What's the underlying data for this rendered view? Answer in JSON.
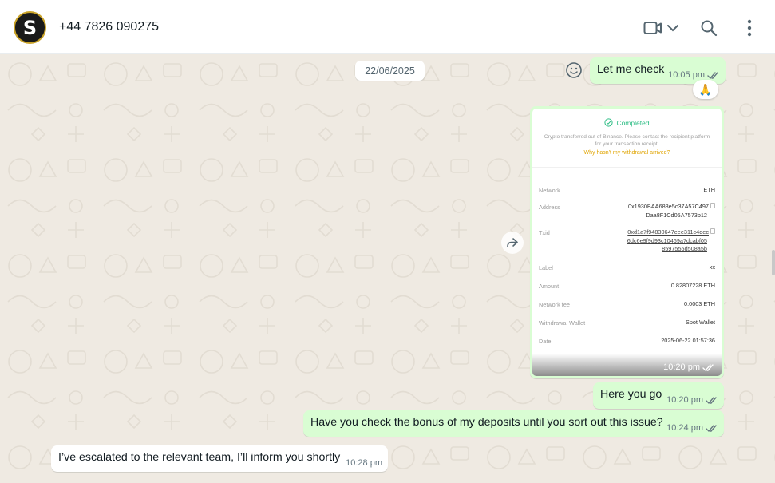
{
  "header": {
    "avatar_letter": "S",
    "contact_name": "+44 7826 090275",
    "icons": [
      "video-call-icon",
      "chevron-down-icon",
      "search-icon",
      "more-options-icon"
    ]
  },
  "chat": {
    "date_label": "22/06/2025",
    "messages": [
      {
        "direction": "out",
        "text": "Let me check",
        "time": "10:05 pm",
        "status": "read",
        "reaction": "🙏"
      },
      {
        "direction": "out",
        "type": "image",
        "time": "10:20 pm",
        "status": "read"
      },
      {
        "direction": "out",
        "text": "Here you go",
        "time": "10:20 pm",
        "status": "read"
      },
      {
        "direction": "out",
        "text": "Have you check the bonus of my deposits until you sort out this issue?",
        "time": "10:24 pm",
        "status": "read"
      },
      {
        "direction": "in",
        "text": "I’ve escalated to the relevant team, I’ll inform you shortly",
        "time": "10:28 pm"
      }
    ],
    "receipt": {
      "status": "Completed",
      "note": "Crypto transferred out of Binance. Please contact the recipient platform for your transaction receipt.",
      "link": "Why hasn't my withdrawal arrived?",
      "rows": [
        {
          "label": "Network",
          "value": "ETH"
        },
        {
          "label": "Address",
          "value_lines": [
            "0x1930BAA688e5c37A57C497",
            "Daa8F1Cd05A7573b12"
          ]
        },
        {
          "label": "Txid",
          "value_lines": [
            "0xd1a7f94830647eee311c4dec",
            "6dc6e9f9d93c10469a7dcabf05",
            "8597555d508a5b"
          ]
        },
        {
          "label": "Label",
          "value": "xx"
        },
        {
          "label": "Amount",
          "value": "0.82807228 ETH"
        },
        {
          "label": "Network fee",
          "value": "0.0003 ETH"
        },
        {
          "label": "Withdrawal Wallet",
          "value": "Spot Wallet"
        },
        {
          "label": "Date",
          "value": "2025-06-22 01:57:36"
        }
      ]
    }
  },
  "colors": {
    "outgoing_bubble": "#d9fdd3",
    "incoming_bubble": "#ffffff",
    "chat_background": "#efeae2",
    "read_tick": "#53bdeb",
    "completed_green": "#2ebd85",
    "link_gold": "#e0a400"
  }
}
